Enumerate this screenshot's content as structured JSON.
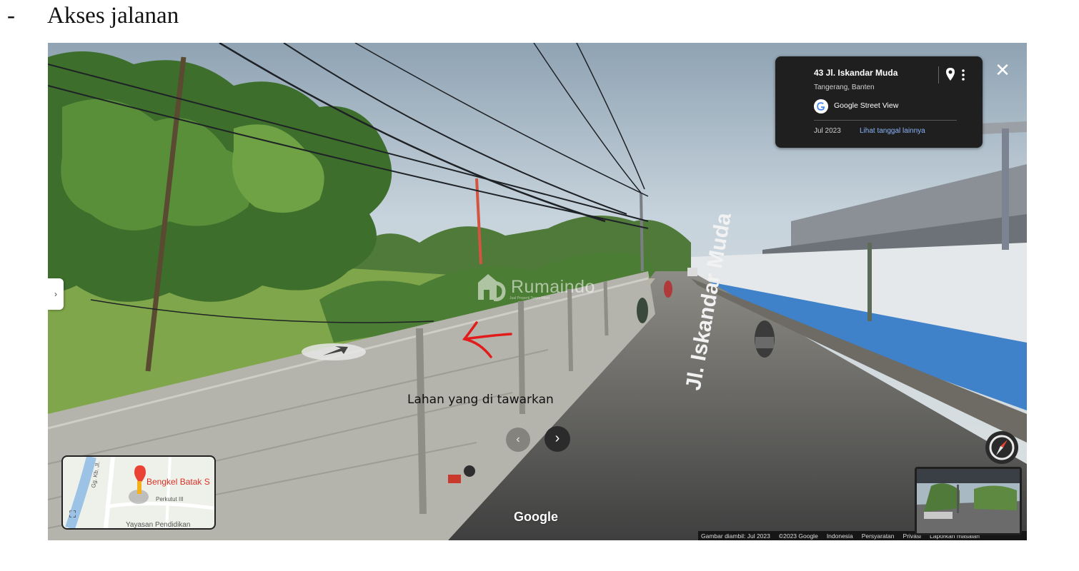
{
  "heading": {
    "bullet": "-",
    "text": "Akses jalanan"
  },
  "streetview": {
    "info": {
      "address": "43 Jl. Iskandar Muda",
      "city": "Tangerang, Banten",
      "brand": "Google Street View",
      "date": "Jul 2023",
      "link": "Lihat tanggal lainnya"
    },
    "close_symbol": "✕",
    "side_tab_symbol": "›",
    "road_text": "Jl. Iskandar Muda",
    "watermark": {
      "text": "Rumaindo",
      "sub": "Jual Properti Tanpa Ribet"
    },
    "land_label": "Lahan yang di tawarkan",
    "nav": {
      "prev": "‹",
      "next": "›"
    },
    "minimap": {
      "place": "Bengkel Batak S",
      "street_1": "Gg. Kb. Jl.",
      "street_2": "Perkutut III",
      "school": "Yayasan Pendidikan"
    },
    "google_logo": "Google",
    "footer": [
      "Gambar diambil: Jul 2023",
      "©2023 Google",
      "Indonesia",
      "Persyaratan",
      "Privasi",
      "Laporkan masalah"
    ],
    "colors": {
      "card_bg": "#1f1f1f",
      "link": "#8ab4f8",
      "pin_red": "#ea4335",
      "arrow_red": "#e21b1b",
      "wall_blue": "#3f82c9"
    }
  }
}
